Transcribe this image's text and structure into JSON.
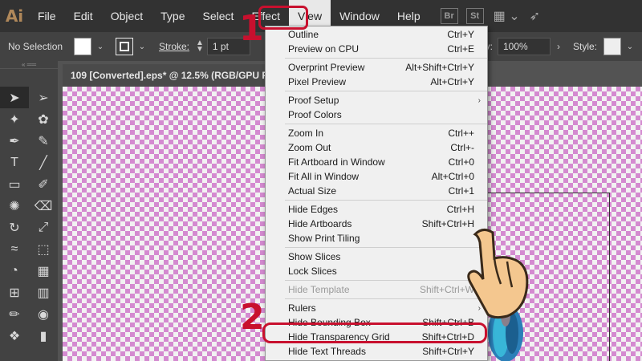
{
  "app": {
    "logo": "Ai"
  },
  "menubar": {
    "items": [
      "File",
      "Edit",
      "Object",
      "Type",
      "Select",
      "Effect",
      "View",
      "Window",
      "Help"
    ],
    "active": "View",
    "bridge": "Br",
    "stock": "St"
  },
  "controlbar": {
    "selection": "No Selection",
    "stroke_label": "Stroke:",
    "stroke_value": "1 pt",
    "opacity_label": "pacity:",
    "opacity_value": "100%",
    "style_label": "Style:"
  },
  "document": {
    "tab_title": "109 [Converted].eps* @ 12.5% (RGB/GPU P"
  },
  "view_menu": {
    "groups": [
      [
        {
          "label": "Outline",
          "shortcut": "Ctrl+Y"
        },
        {
          "label": "Preview on CPU",
          "shortcut": "Ctrl+E"
        }
      ],
      [
        {
          "label": "Overprint Preview",
          "shortcut": "Alt+Shift+Ctrl+Y"
        },
        {
          "label": "Pixel Preview",
          "shortcut": "Alt+Ctrl+Y"
        }
      ],
      [
        {
          "label": "Proof Setup",
          "shortcut": "",
          "submenu": true
        },
        {
          "label": "Proof Colors",
          "shortcut": ""
        }
      ],
      [
        {
          "label": "Zoom In",
          "shortcut": "Ctrl++"
        },
        {
          "label": "Zoom Out",
          "shortcut": "Ctrl+-"
        },
        {
          "label": "Fit Artboard in Window",
          "shortcut": "Ctrl+0"
        },
        {
          "label": "Fit All in Window",
          "shortcut": "Alt+Ctrl+0"
        },
        {
          "label": "Actual Size",
          "shortcut": "Ctrl+1"
        }
      ],
      [
        {
          "label": "Hide Edges",
          "shortcut": "Ctrl+H"
        },
        {
          "label": "Hide Artboards",
          "shortcut": "Shift+Ctrl+H"
        },
        {
          "label": "Show Print Tiling",
          "shortcut": ""
        }
      ],
      [
        {
          "label": "Show Slices",
          "shortcut": ""
        },
        {
          "label": "Lock Slices",
          "shortcut": ""
        }
      ],
      [
        {
          "label": "Hide Template",
          "shortcut": "Shift+Ctrl+W",
          "disabled": true
        }
      ],
      [
        {
          "label": "Rulers",
          "shortcut": "",
          "submenu": true
        },
        {
          "label": "Hide Bounding Box",
          "shortcut": "Shift+Ctrl+B"
        },
        {
          "label": "Hide Transparency Grid",
          "shortcut": "Shift+Ctrl+D"
        },
        {
          "label": "Hide Text Threads",
          "shortcut": "Shift+Ctrl+Y"
        }
      ]
    ]
  },
  "annotations": {
    "step1": "1",
    "step2": "2",
    "accent_color": "#c8102e"
  },
  "icons": {
    "tools": [
      "selection-tool-icon",
      "direct-selection-tool-icon",
      "magic-wand-icon",
      "lasso-icon",
      "pen-tool-icon",
      "curvature-tool-icon",
      "type-tool-icon",
      "line-tool-icon",
      "rectangle-tool-icon",
      "paintbrush-icon",
      "shaper-tool-icon",
      "eraser-icon",
      "rotate-tool-icon",
      "scale-tool-icon",
      "warp-tool-icon",
      "free-transform-icon",
      "shape-builder-icon",
      "perspective-grid-icon",
      "mesh-tool-icon",
      "gradient-tool-icon",
      "eyedropper-icon",
      "blend-tool-icon",
      "symbol-sprayer-icon",
      "column-graph-icon"
    ]
  }
}
